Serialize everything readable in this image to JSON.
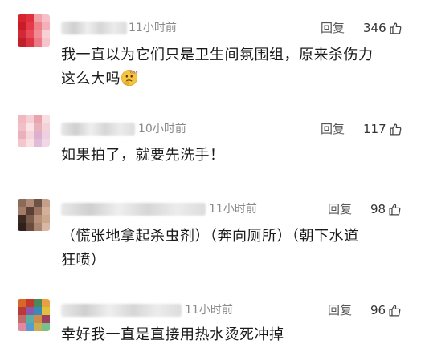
{
  "comments": [
    {
      "time": "11小时前",
      "reply_label": "回复",
      "likes": "346",
      "text_line1": "我一直以为它们只是卫生间氛围组，原来杀伤力",
      "text_line2": "这么大吗",
      "emoji_icon": "thinking-face-emoji",
      "avatar_colors": [
        "#d8242f",
        "#e03040",
        "#f2a0a8",
        "#f6c0c8",
        "#c81c28",
        "#e63a48",
        "#ee8088",
        "#f4b0b8",
        "#d02a36",
        "#ea4a58",
        "#f08a94",
        "#f8d0d6",
        "#c0202c",
        "#dc3442",
        "#ec7a86",
        "#f6c4cc"
      ]
    },
    {
      "time": "10小时前",
      "reply_label": "回复",
      "likes": "117",
      "text_line1": "如果拍了，就要先洗手！",
      "avatar_colors": [
        "#f2b8bf",
        "#f6cfd4",
        "#eaa4ae",
        "#f8dde1",
        "#f0c0c6",
        "#fbe3e6",
        "#e8b2bb",
        "#f4d2d7",
        "#eab0bb",
        "#f6d6db",
        "#dcb0d0",
        "#f0cfe0",
        "#f4c6cc",
        "#f9e0e4",
        "#e0bcd8",
        "#f2d8e6"
      ]
    },
    {
      "time": "11小时前",
      "reply_label": "回复",
      "likes": "98",
      "text_line1": "（慌张地拿起杀虫剂）（奔向厕所）（朝下水道",
      "text_line2": "狂喷）",
      "avatar_colors": [
        "#8a6a58",
        "#b08a74",
        "#6e5446",
        "#c4a08a",
        "#a47c66",
        "#5a4036",
        "#9a7460",
        "#d2b09a",
        "#3c2a22",
        "#7a5a48",
        "#b89078",
        "#caa88e",
        "#2e201a",
        "#6a4c3c",
        "#a88672",
        "#d8b8a2"
      ]
    },
    {
      "time": "11小时前",
      "reply_label": "回复",
      "likes": "96",
      "text_line1": "幸好我一直是直接用热水烫死冲掉",
      "avatar_colors": [
        "#d8682a",
        "#c43a2a",
        "#4a8a5a",
        "#e8a040",
        "#b83a3a",
        "#8a5aa8",
        "#3a8ab8",
        "#e0c040",
        "#c06a6a",
        "#5ab0a0",
        "#d08a4a",
        "#a04060",
        "#e08aa0",
        "#5a9ad0",
        "#c8b050",
        "#7ac08a"
      ]
    }
  ]
}
